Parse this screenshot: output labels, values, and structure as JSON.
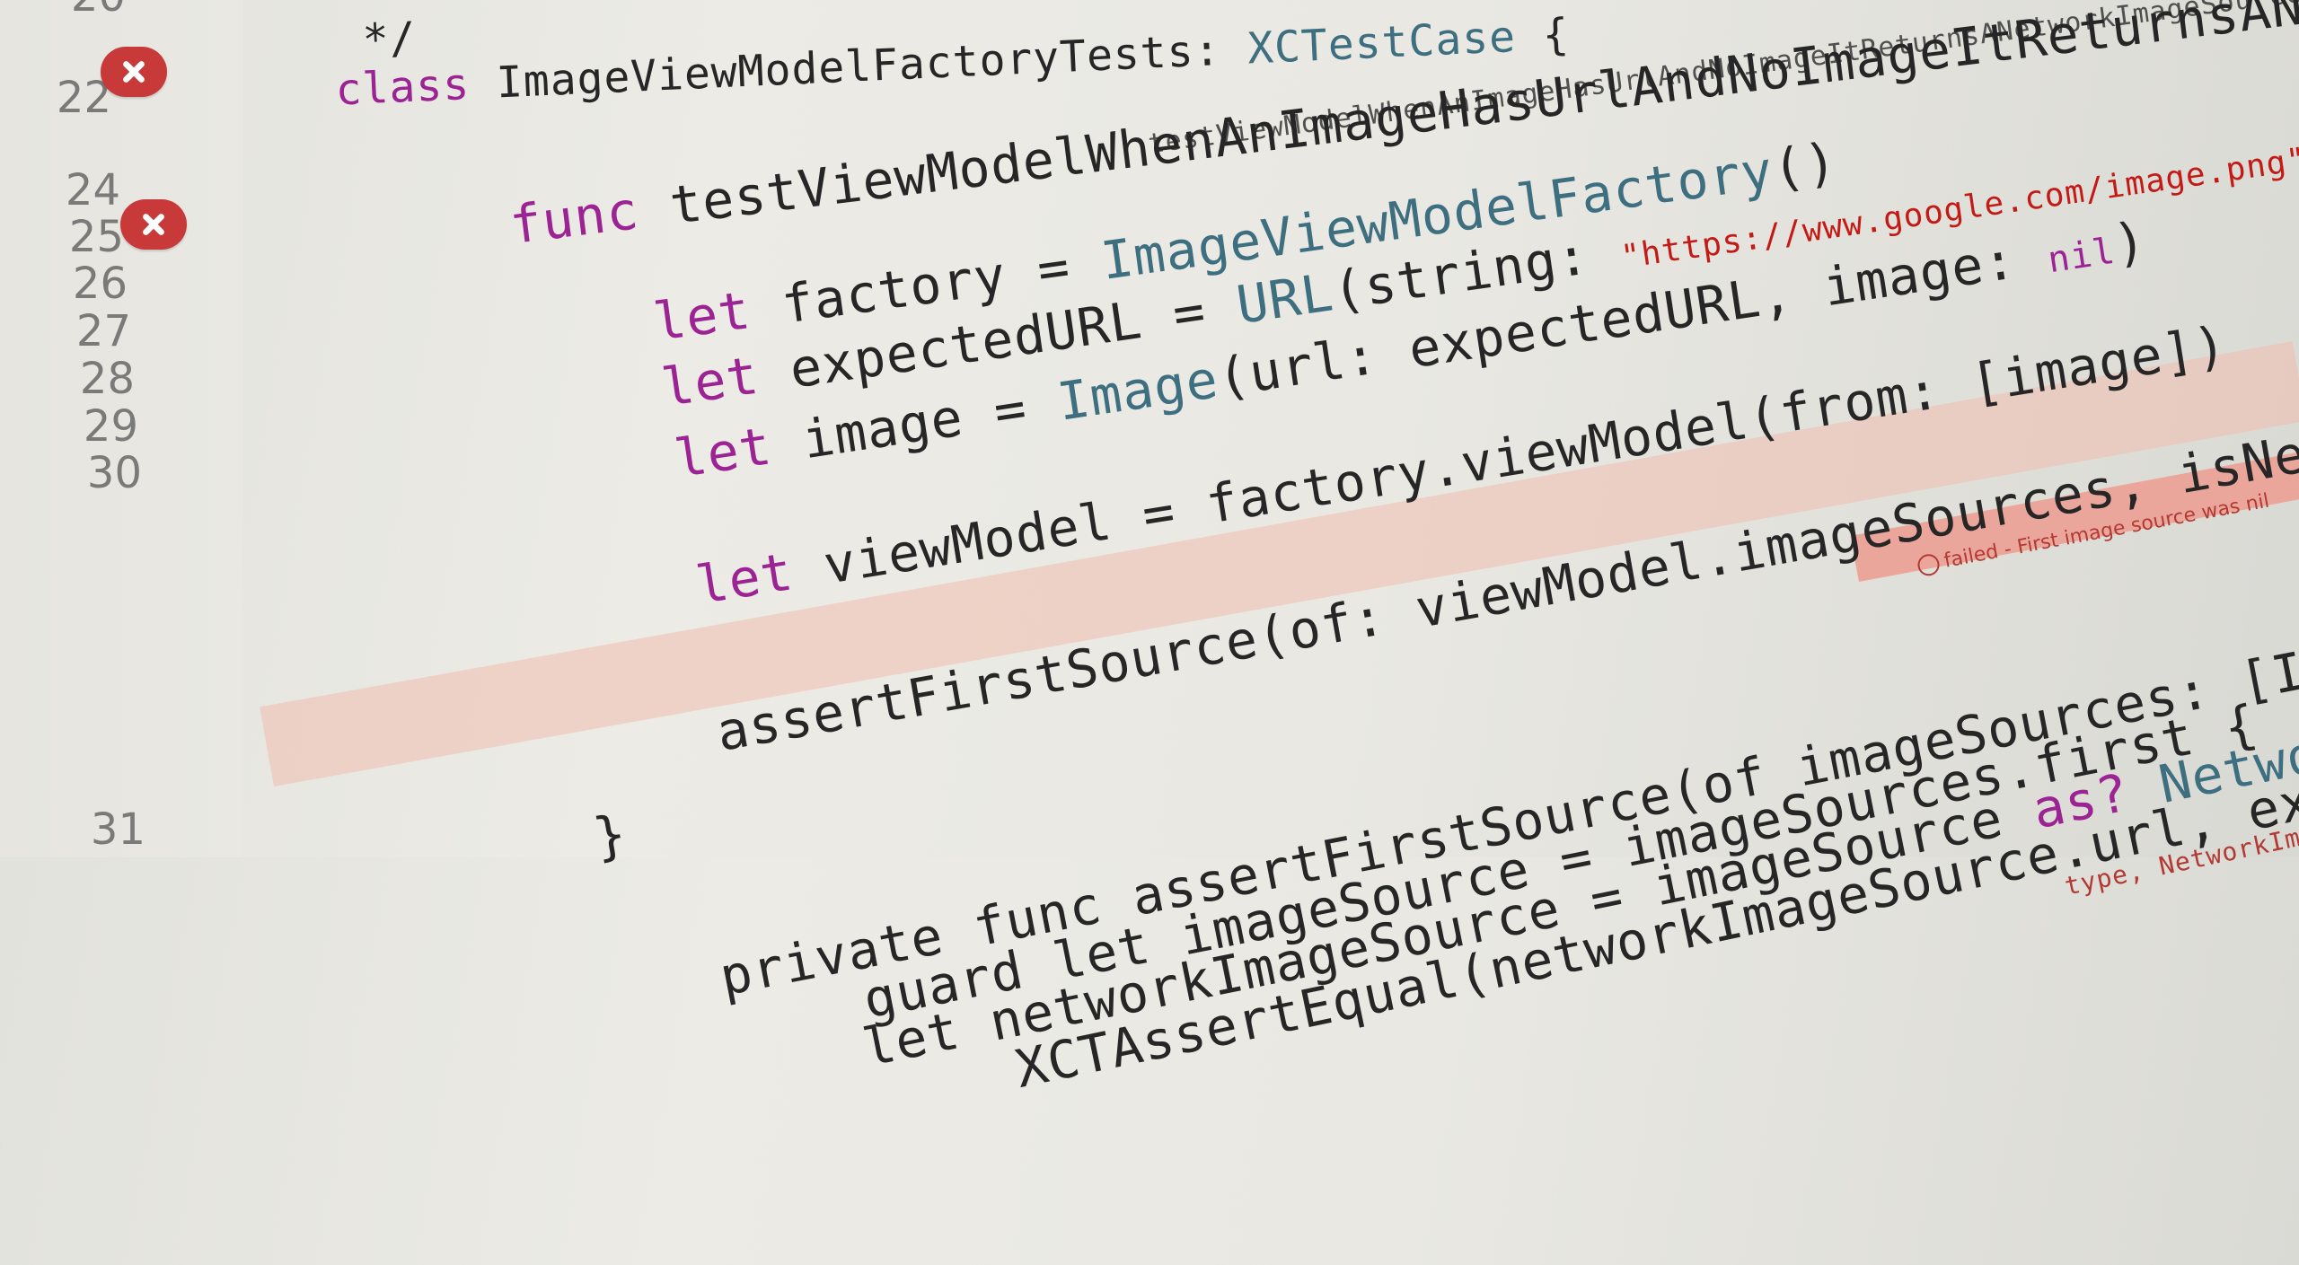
{
  "gutter": {
    "line_numbers": [
      "20",
      "22",
      "24",
      "25",
      "26",
      "27",
      "28",
      "29",
      "30",
      "31"
    ]
  },
  "code": {
    "line20": "*/",
    "line21_kw": "class",
    "line21_name": " ImageViewModelFactoryTests: ",
    "line21_type": "XCTestCase",
    "line21_end": " {",
    "line22_small": "testViewModelWhenAnImageHasUrlAndNoImageItReturnsANetworkImageSourceWithTheSameUrl() {",
    "line23_kw": "func",
    "line23_name": " testViewModelWhenAnImageHasUrlAndNoImageItReturnsANetworkImageSourceWithTheSameUrl() {",
    "line24_kw": "let",
    "line24_a": " factory = ",
    "line24_type": "ImageViewModelFactory",
    "line24_b": "()",
    "line25_kw": "let",
    "line25_a": " expectedURL = ",
    "line25_type": "URL",
    "line25_b": "(string: ",
    "line25_str": "\"https://www.google.com/image.png\"",
    "line25_c": ")",
    "line26_kw": "let",
    "line26_a": " image = ",
    "line26_type": "Image",
    "line26_b": "(url: expectedURL, image: ",
    "line26_nil": "nil",
    "line26_c": ")",
    "line27_kw": "let",
    "line27_a": " viewModel = factory.viewModel(from: [image])",
    "line29_a": "assertFirstSource(of: viewModel.imageSources, isNetworkWithURL: expectedURL)",
    "line30": "}",
    "line31_a": "    private func assertFirstSource(of imageSources: [ImageSource], isNetworkWithURL expectedURL: URL, file: StaticString = #file, line: UInt = #line) {",
    "line32_a": "        guard let imageSource = imageSources.first {",
    "line33_a": "        let networkImageSource = imageSource ",
    "line33_kw": "as?",
    "line33_type": " NetworkImageSource",
    "line33_b": " {",
    "line34_a": "            XCTAssertEqual(networkImageSource.url, expectedURL, file: file, line: line)",
    "line35_a": "type, NetworkImageSo"
  },
  "error_message": {
    "text": "failed - First image source was nil"
  }
}
